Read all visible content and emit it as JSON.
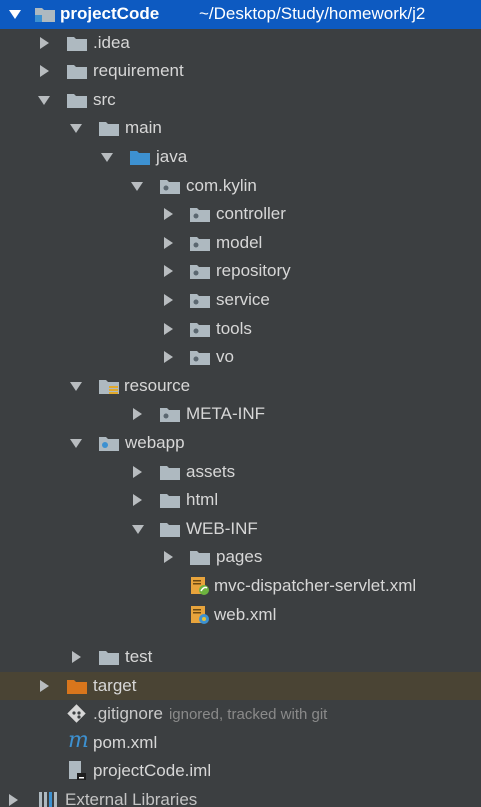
{
  "project": {
    "name": "projectCode",
    "path": "~/Desktop/Study/homework/j2"
  },
  "nodes": {
    "idea": ".idea",
    "requirement": "requirement",
    "src": "src",
    "main": "main",
    "java": "java",
    "package": "com.kylin",
    "controller": "controller",
    "model": "model",
    "repository": "repository",
    "service": "service",
    "tools": "tools",
    "vo": "vo",
    "resource": "resource",
    "metainf": "META-INF",
    "webapp": "webapp",
    "assets": "assets",
    "html": "html",
    "webinf": "WEB-INF",
    "pages": "pages",
    "dispatcher": "mvc-dispatcher-servlet.xml",
    "webxml": "web.xml",
    "test": "test",
    "target": "target",
    "gitignore": ".gitignore",
    "gitignore_hint": "ignored, tracked with git",
    "pom": "pom.xml",
    "iml": "projectCode.iml",
    "external": "External Libraries"
  },
  "colors": {
    "background": "#3c3f41",
    "selection": "#0d5ac1",
    "excluded_highlight": "#4a4434",
    "folder": "#aeb9c0",
    "source_folder": "#3d91d1",
    "excluded_folder": "#d9761c"
  }
}
